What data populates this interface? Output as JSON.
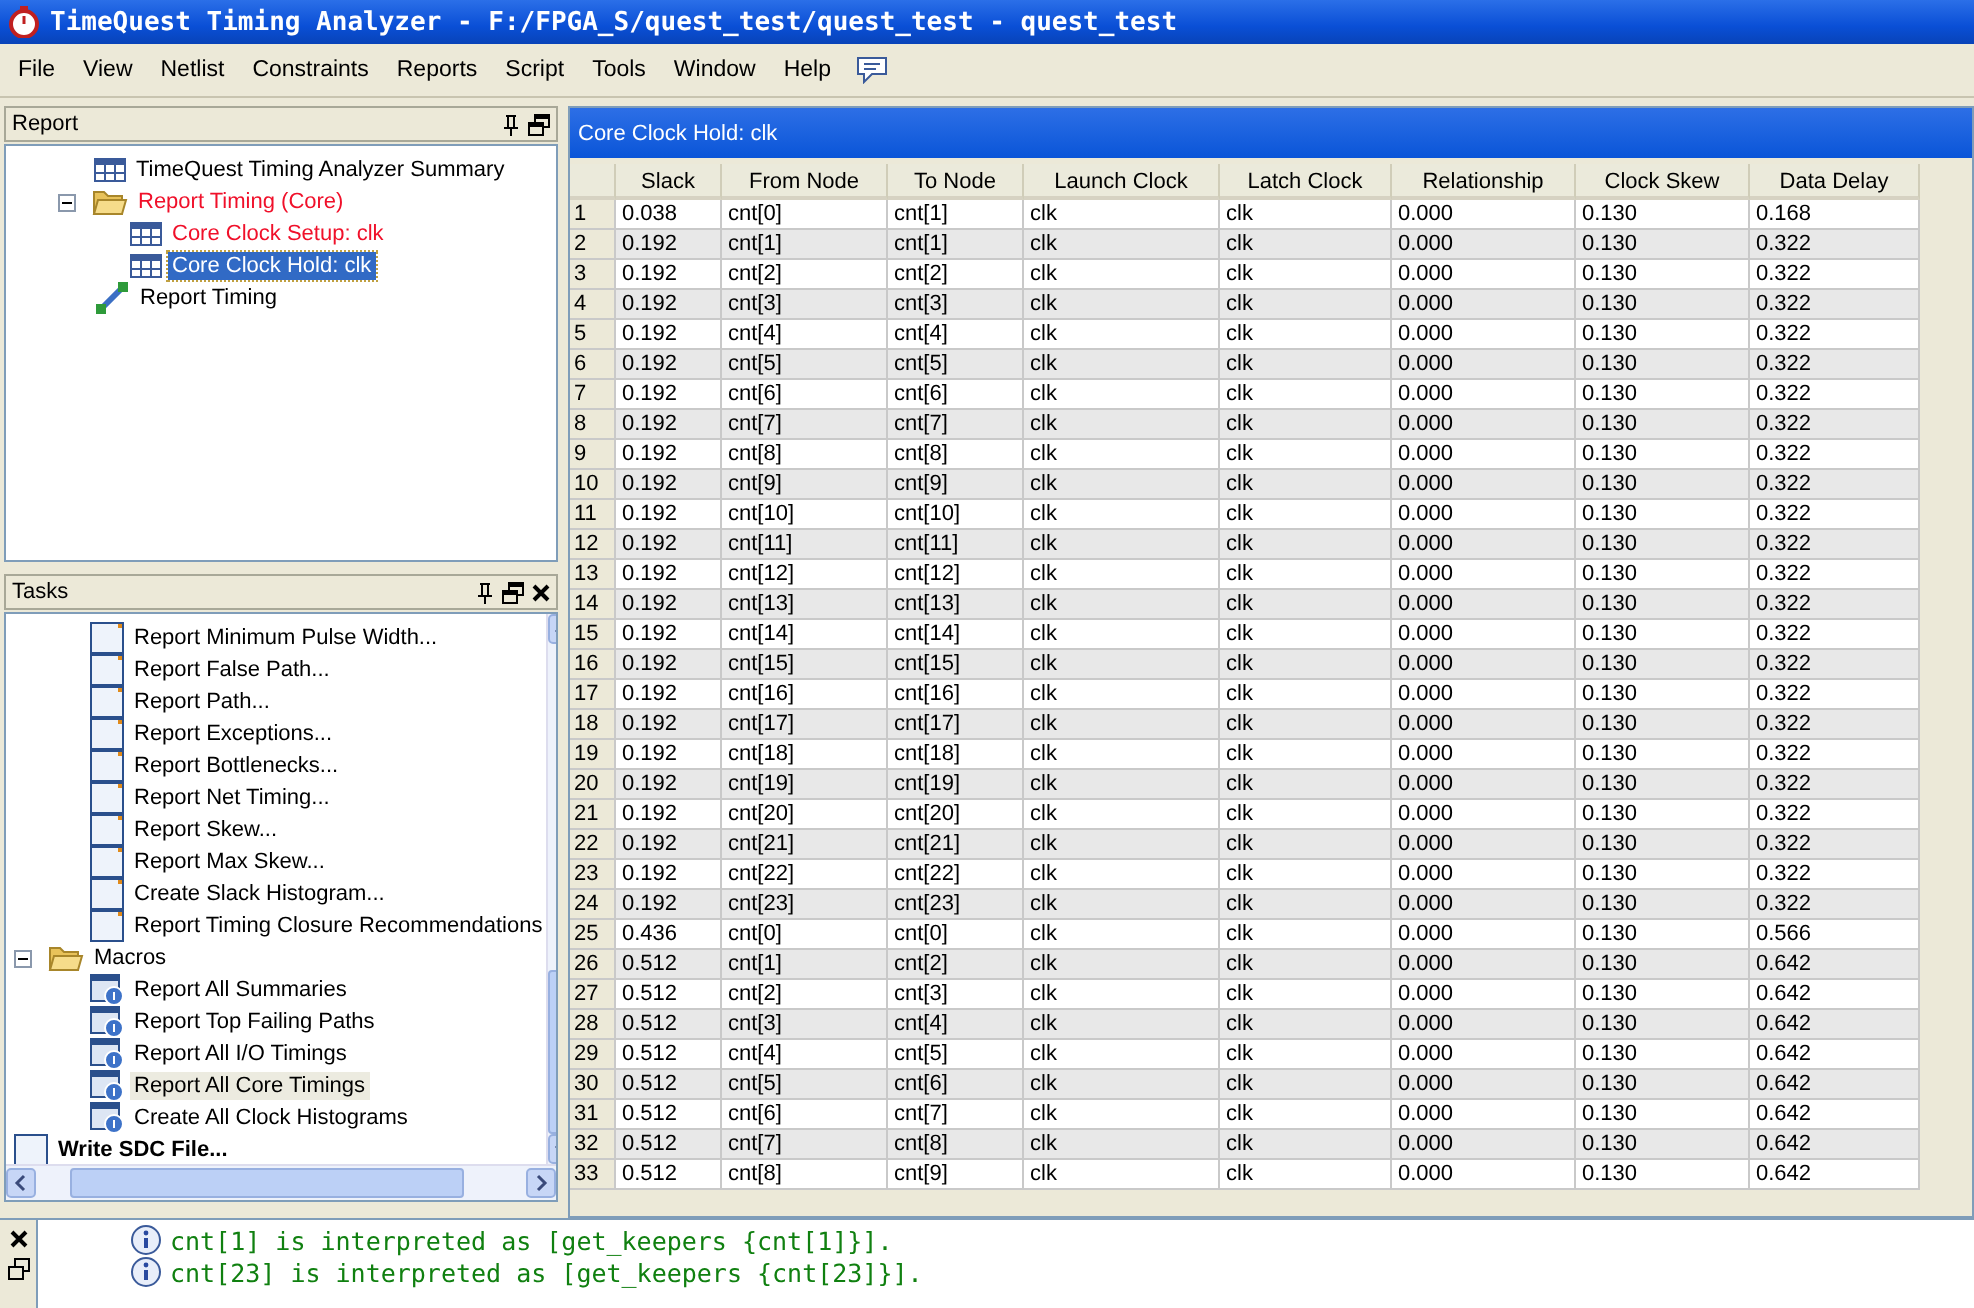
{
  "window": {
    "title": "TimeQuest Timing Analyzer - F:/FPGA_S/quest_test/quest_test - quest_test"
  },
  "menu": [
    "File",
    "View",
    "Netlist",
    "Constraints",
    "Reports",
    "Script",
    "Tools",
    "Window",
    "Help"
  ],
  "report_pane": {
    "title": "Report",
    "items": [
      {
        "label": "TimeQuest Timing Analyzer Summary",
        "kind": "table",
        "selected": false,
        "violated": false
      },
      {
        "label": "Report Timing (Core)",
        "kind": "folder",
        "expanded": true,
        "selected": false,
        "violated": true,
        "children": [
          {
            "label": "Core Clock Setup: clk",
            "kind": "table",
            "selected": false,
            "violated": true
          },
          {
            "label": "Core Clock Hold: clk",
            "kind": "table",
            "selected": true,
            "violated": false
          }
        ]
      },
      {
        "label": "Report Timing",
        "kind": "tool",
        "selected": false,
        "violated": false
      }
    ]
  },
  "tasks_pane": {
    "title": "Tasks",
    "items": [
      {
        "kind": "partial-group",
        "children": [
          {
            "label": "Report Minimum Pulse Width...",
            "kind": "task",
            "selected": false
          },
          {
            "label": "Report False Path...",
            "kind": "task",
            "selected": false
          },
          {
            "label": "Report Path...",
            "kind": "task",
            "selected": false
          },
          {
            "label": "Report Exceptions...",
            "kind": "task",
            "selected": false
          },
          {
            "label": "Report Bottlenecks...",
            "kind": "task",
            "selected": false
          },
          {
            "label": "Report Net Timing...",
            "kind": "task",
            "selected": false
          },
          {
            "label": "Report Skew...",
            "kind": "task",
            "selected": false
          },
          {
            "label": "Report Max Skew...",
            "kind": "task",
            "selected": false
          },
          {
            "label": "Create Slack Histogram...",
            "kind": "task",
            "selected": false
          },
          {
            "label": "Report Timing Closure Recommendations",
            "kind": "task",
            "selected": false
          }
        ]
      },
      {
        "label": "Macros",
        "kind": "folder",
        "expanded": true,
        "selected": false,
        "children": [
          {
            "label": "Report All Summaries",
            "kind": "macro",
            "selected": false
          },
          {
            "label": "Report Top Failing Paths",
            "kind": "macro",
            "selected": false
          },
          {
            "label": "Report All I/O Timings",
            "kind": "macro",
            "selected": false
          },
          {
            "label": "Report All Core Timings",
            "kind": "macro",
            "selected": true
          },
          {
            "label": "Create All Clock Histograms",
            "kind": "macro",
            "selected": false
          }
        ]
      },
      {
        "label": "Write SDC File...",
        "kind": "command",
        "selected": false
      }
    ]
  },
  "report_view": {
    "title": "Core Clock Hold: clk",
    "table": {
      "columns": [
        "",
        "Slack",
        "From Node",
        "To Node",
        "Launch Clock",
        "Latch Clock",
        "Relationship",
        "Clock Skew",
        "Data Delay"
      ],
      "rows": [
        [
          "1",
          "0.038",
          "cnt[0]",
          "cnt[1]",
          "clk",
          "clk",
          "0.000",
          "0.130",
          "0.168"
        ],
        [
          "2",
          "0.192",
          "cnt[1]",
          "cnt[1]",
          "clk",
          "clk",
          "0.000",
          "0.130",
          "0.322"
        ],
        [
          "3",
          "0.192",
          "cnt[2]",
          "cnt[2]",
          "clk",
          "clk",
          "0.000",
          "0.130",
          "0.322"
        ],
        [
          "4",
          "0.192",
          "cnt[3]",
          "cnt[3]",
          "clk",
          "clk",
          "0.000",
          "0.130",
          "0.322"
        ],
        [
          "5",
          "0.192",
          "cnt[4]",
          "cnt[4]",
          "clk",
          "clk",
          "0.000",
          "0.130",
          "0.322"
        ],
        [
          "6",
          "0.192",
          "cnt[5]",
          "cnt[5]",
          "clk",
          "clk",
          "0.000",
          "0.130",
          "0.322"
        ],
        [
          "7",
          "0.192",
          "cnt[6]",
          "cnt[6]",
          "clk",
          "clk",
          "0.000",
          "0.130",
          "0.322"
        ],
        [
          "8",
          "0.192",
          "cnt[7]",
          "cnt[7]",
          "clk",
          "clk",
          "0.000",
          "0.130",
          "0.322"
        ],
        [
          "9",
          "0.192",
          "cnt[8]",
          "cnt[8]",
          "clk",
          "clk",
          "0.000",
          "0.130",
          "0.322"
        ],
        [
          "10",
          "0.192",
          "cnt[9]",
          "cnt[9]",
          "clk",
          "clk",
          "0.000",
          "0.130",
          "0.322"
        ],
        [
          "11",
          "0.192",
          "cnt[10]",
          "cnt[10]",
          "clk",
          "clk",
          "0.000",
          "0.130",
          "0.322"
        ],
        [
          "12",
          "0.192",
          "cnt[11]",
          "cnt[11]",
          "clk",
          "clk",
          "0.000",
          "0.130",
          "0.322"
        ],
        [
          "13",
          "0.192",
          "cnt[12]",
          "cnt[12]",
          "clk",
          "clk",
          "0.000",
          "0.130",
          "0.322"
        ],
        [
          "14",
          "0.192",
          "cnt[13]",
          "cnt[13]",
          "clk",
          "clk",
          "0.000",
          "0.130",
          "0.322"
        ],
        [
          "15",
          "0.192",
          "cnt[14]",
          "cnt[14]",
          "clk",
          "clk",
          "0.000",
          "0.130",
          "0.322"
        ],
        [
          "16",
          "0.192",
          "cnt[15]",
          "cnt[15]",
          "clk",
          "clk",
          "0.000",
          "0.130",
          "0.322"
        ],
        [
          "17",
          "0.192",
          "cnt[16]",
          "cnt[16]",
          "clk",
          "clk",
          "0.000",
          "0.130",
          "0.322"
        ],
        [
          "18",
          "0.192",
          "cnt[17]",
          "cnt[17]",
          "clk",
          "clk",
          "0.000",
          "0.130",
          "0.322"
        ],
        [
          "19",
          "0.192",
          "cnt[18]",
          "cnt[18]",
          "clk",
          "clk",
          "0.000",
          "0.130",
          "0.322"
        ],
        [
          "20",
          "0.192",
          "cnt[19]",
          "cnt[19]",
          "clk",
          "clk",
          "0.000",
          "0.130",
          "0.322"
        ],
        [
          "21",
          "0.192",
          "cnt[20]",
          "cnt[20]",
          "clk",
          "clk",
          "0.000",
          "0.130",
          "0.322"
        ],
        [
          "22",
          "0.192",
          "cnt[21]",
          "cnt[21]",
          "clk",
          "clk",
          "0.000",
          "0.130",
          "0.322"
        ],
        [
          "23",
          "0.192",
          "cnt[22]",
          "cnt[22]",
          "clk",
          "clk",
          "0.000",
          "0.130",
          "0.322"
        ],
        [
          "24",
          "0.192",
          "cnt[23]",
          "cnt[23]",
          "clk",
          "clk",
          "0.000",
          "0.130",
          "0.322"
        ],
        [
          "25",
          "0.436",
          "cnt[0]",
          "cnt[0]",
          "clk",
          "clk",
          "0.000",
          "0.130",
          "0.566"
        ],
        [
          "26",
          "0.512",
          "cnt[1]",
          "cnt[2]",
          "clk",
          "clk",
          "0.000",
          "0.130",
          "0.642"
        ],
        [
          "27",
          "0.512",
          "cnt[2]",
          "cnt[3]",
          "clk",
          "clk",
          "0.000",
          "0.130",
          "0.642"
        ],
        [
          "28",
          "0.512",
          "cnt[3]",
          "cnt[4]",
          "clk",
          "clk",
          "0.000",
          "0.130",
          "0.642"
        ],
        [
          "29",
          "0.512",
          "cnt[4]",
          "cnt[5]",
          "clk",
          "clk",
          "0.000",
          "0.130",
          "0.642"
        ],
        [
          "30",
          "0.512",
          "cnt[5]",
          "cnt[6]",
          "clk",
          "clk",
          "0.000",
          "0.130",
          "0.642"
        ],
        [
          "31",
          "0.512",
          "cnt[6]",
          "cnt[7]",
          "clk",
          "clk",
          "0.000",
          "0.130",
          "0.642"
        ],
        [
          "32",
          "0.512",
          "cnt[7]",
          "cnt[8]",
          "clk",
          "clk",
          "0.000",
          "0.130",
          "0.642"
        ],
        [
          "33",
          "0.512",
          "cnt[8]",
          "cnt[9]",
          "clk",
          "clk",
          "0.000",
          "0.130",
          "0.642"
        ]
      ]
    }
  },
  "console": {
    "messages": [
      {
        "kind": "info",
        "text": "cnt[1] is interpreted as [get_keepers {cnt[1]}]."
      },
      {
        "kind": "info",
        "text": "cnt[23] is interpreted as [get_keepers {cnt[23]}]."
      }
    ]
  }
}
